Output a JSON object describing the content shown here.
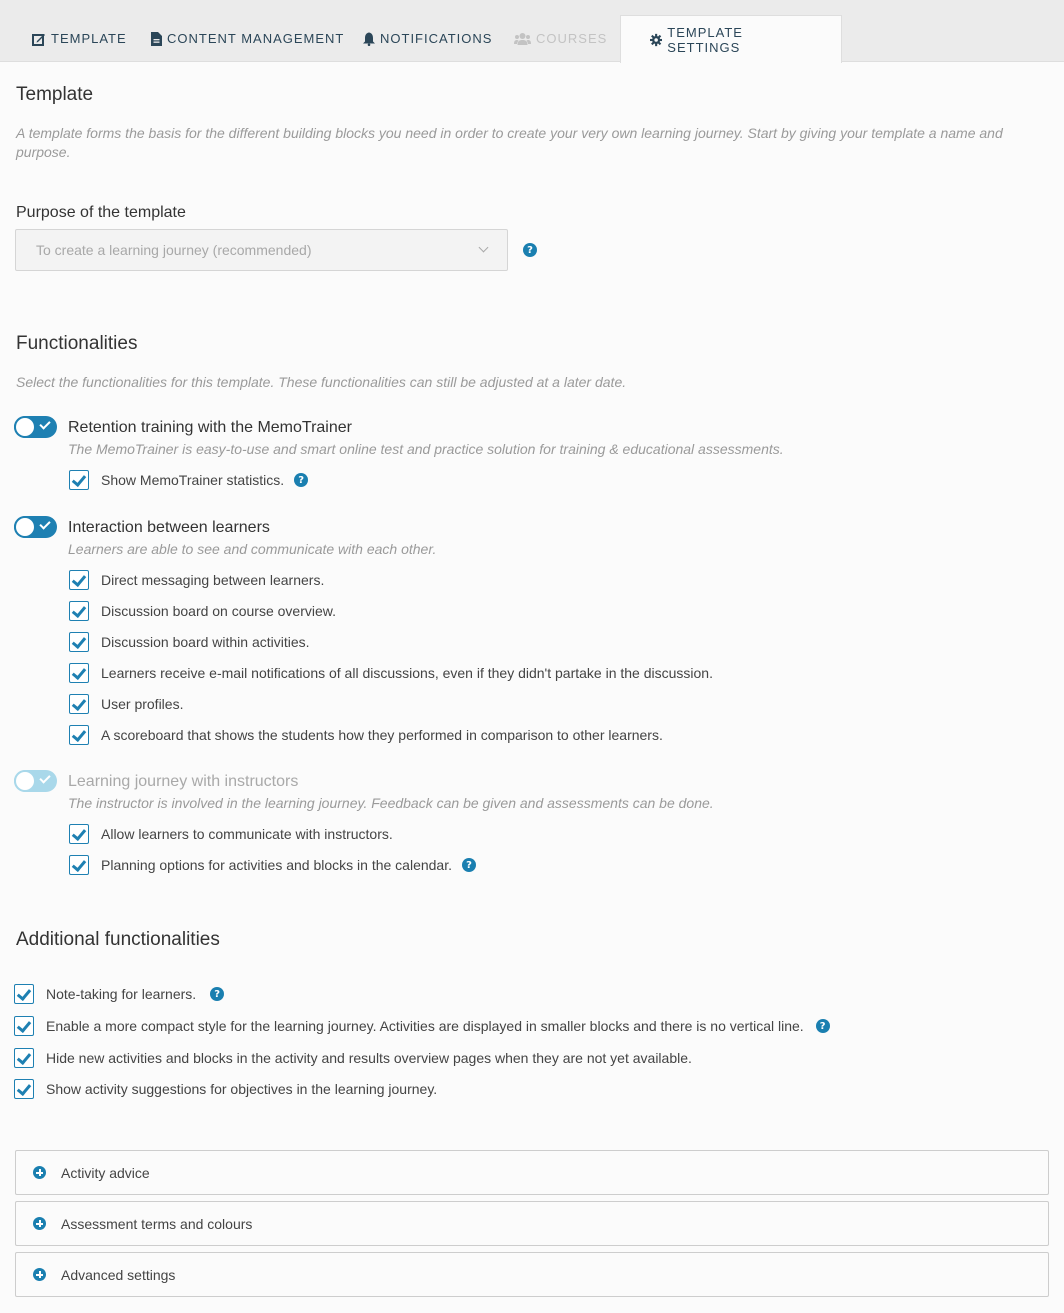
{
  "tabs": [
    {
      "label": "TEMPLATE",
      "icon": "edit-icon",
      "state": "normal"
    },
    {
      "label": "CONTENT MANAGEMENT",
      "icon": "document-icon",
      "state": "normal"
    },
    {
      "label": "NOTIFICATIONS",
      "icon": "bell-icon",
      "state": "normal"
    },
    {
      "label": "COURSES",
      "icon": "users-icon",
      "state": "disabled"
    },
    {
      "label": "TEMPLATE SETTINGS",
      "icon": "gear-icon",
      "state": "active"
    }
  ],
  "template": {
    "title": "Template",
    "description": "A template forms the basis for the different building blocks you need in order to create your very own learning journey. Start by giving your template a name and purpose.",
    "purpose_label": "Purpose of the template",
    "purpose_value": "To create a learning journey (recommended)"
  },
  "functionalities": {
    "title": "Functionalities",
    "description": "Select the functionalities for this template. These functionalities can still be adjusted at a later date.",
    "groups": [
      {
        "title": "Retention training with the MemoTrainer",
        "description": "The MemoTrainer is easy-to-use and smart online test and practice solution for training & educational assessments.",
        "enabled": true,
        "disabled": false,
        "options": [
          {
            "label": "Show MemoTrainer statistics.",
            "checked": true,
            "help": true
          }
        ]
      },
      {
        "title": "Interaction between learners",
        "description": "Learners are able to see and communicate with each other.",
        "enabled": true,
        "disabled": false,
        "options": [
          {
            "label": "Direct messaging between learners.",
            "checked": true,
            "help": false
          },
          {
            "label": "Discussion board on course overview.",
            "checked": true,
            "help": false
          },
          {
            "label": "Discussion board within activities.",
            "checked": true,
            "help": false
          },
          {
            "label": "Learners receive e-mail notifications of all discussions, even if they didn't partake in the discussion.",
            "checked": true,
            "help": false
          },
          {
            "label": "User profiles.",
            "checked": true,
            "help": false
          },
          {
            "label": "A scoreboard that shows the students how they performed in comparison to other learners.",
            "checked": true,
            "help": false
          }
        ]
      },
      {
        "title": "Learning journey with instructors",
        "description": "The instructor is involved in the learning journey. Feedback can be given and assessments can be done.",
        "enabled": true,
        "disabled": true,
        "options": [
          {
            "label": "Allow learners to communicate with instructors.",
            "checked": true,
            "help": false
          },
          {
            "label": "Planning options for activities and blocks in the calendar.",
            "checked": true,
            "help": true
          }
        ]
      }
    ]
  },
  "additional": {
    "title": "Additional functionalities",
    "options": [
      {
        "label": "Note-taking for learners.",
        "checked": true,
        "help": true
      },
      {
        "label": "Enable a more compact style for the learning journey. Activities are displayed in smaller blocks and there is no vertical line.",
        "checked": true,
        "help": true
      },
      {
        "label": "Hide new activities and blocks in the activity and results overview pages when they are not yet available.",
        "checked": true,
        "help": false
      },
      {
        "label": "Show activity suggestions for objectives in the learning journey.",
        "checked": true,
        "help": false
      }
    ]
  },
  "accordions": [
    {
      "label": "Activity advice"
    },
    {
      "label": "Assessment terms and colours"
    },
    {
      "label": "Advanced settings"
    }
  ],
  "help_glyph": "?",
  "colors": {
    "accent": "#1e80b2",
    "accent_disabled": "#a9d8ea",
    "tab_text": "#2b4658"
  }
}
